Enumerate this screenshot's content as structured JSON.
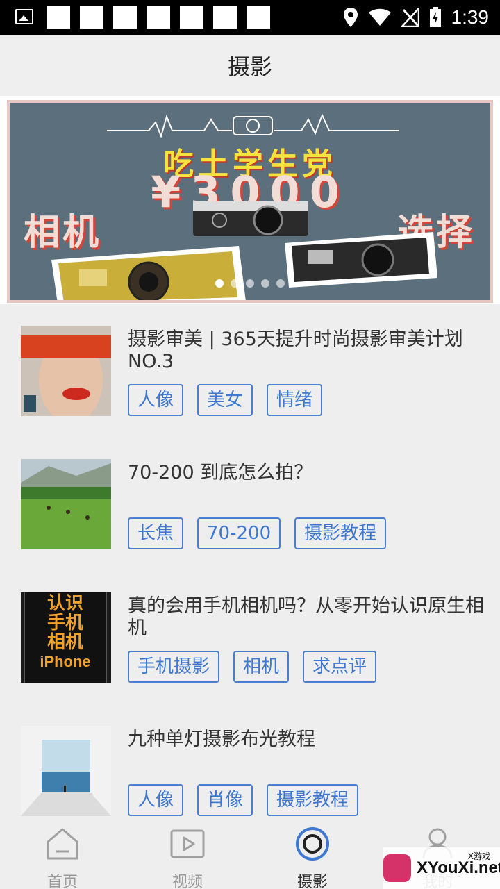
{
  "status_bar": {
    "time": "1:39"
  },
  "header": {
    "title": "摄影"
  },
  "banner": {
    "line1": "吃土学生党",
    "line2": "¥3000",
    "line3_left": "相机",
    "line3_right": "选择",
    "slide_count": 5,
    "active_slide": 1
  },
  "articles": [
    {
      "title": "摄影审美 | 365天提升时尚摄影审美计划NO.3",
      "tags": [
        "人像",
        "美女",
        "情绪"
      ]
    },
    {
      "title": "70-200 到底怎么拍？",
      "tags": [
        "长焦",
        "70-200",
        "摄影教程"
      ]
    },
    {
      "title": "真的会用手机相机吗？从零开始认识原生相机",
      "tags": [
        "手机摄影",
        "相机",
        "求点评"
      ]
    },
    {
      "title": "九种单灯摄影布光教程",
      "tags": [
        "人像",
        "肖像",
        "摄影教程"
      ]
    }
  ],
  "thumb3_text": [
    "认识",
    "手机",
    "相机",
    "iPhone"
  ],
  "bottom_nav": {
    "items": [
      {
        "label": "首页",
        "icon": "home-icon"
      },
      {
        "label": "视频",
        "icon": "video-icon"
      },
      {
        "label": "摄影",
        "icon": "camera-lens-icon"
      },
      {
        "label": "我的",
        "icon": "profile-icon"
      }
    ],
    "active_index": 2
  },
  "watermark": {
    "text": "XYouXi.net",
    "small": "X游戏"
  },
  "colors": {
    "tag_blue": "#3f78d1",
    "active_nav": "#3f78d1",
    "background": "#eeeeee"
  }
}
